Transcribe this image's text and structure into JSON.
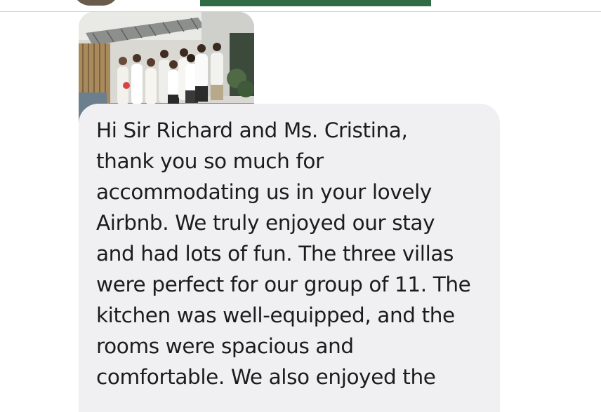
{
  "message": {
    "text": "Hi Sir Richard and Ms. Cristina,\nthank you so much for\naccommodating us in your lovely\nAirbnb. We truly enjoyed our stay\nand had lots of fun. The three villas\nwere perfect for our group of 11. The\nkitchen was well-equipped, and the\nrooms were spacious and\ncomfortable. We also enjoyed the"
  },
  "colors": {
    "bubble_background": "#f0f0f3",
    "text": "#1c1c1e",
    "top_bar_accent": "#2f6b45"
  }
}
